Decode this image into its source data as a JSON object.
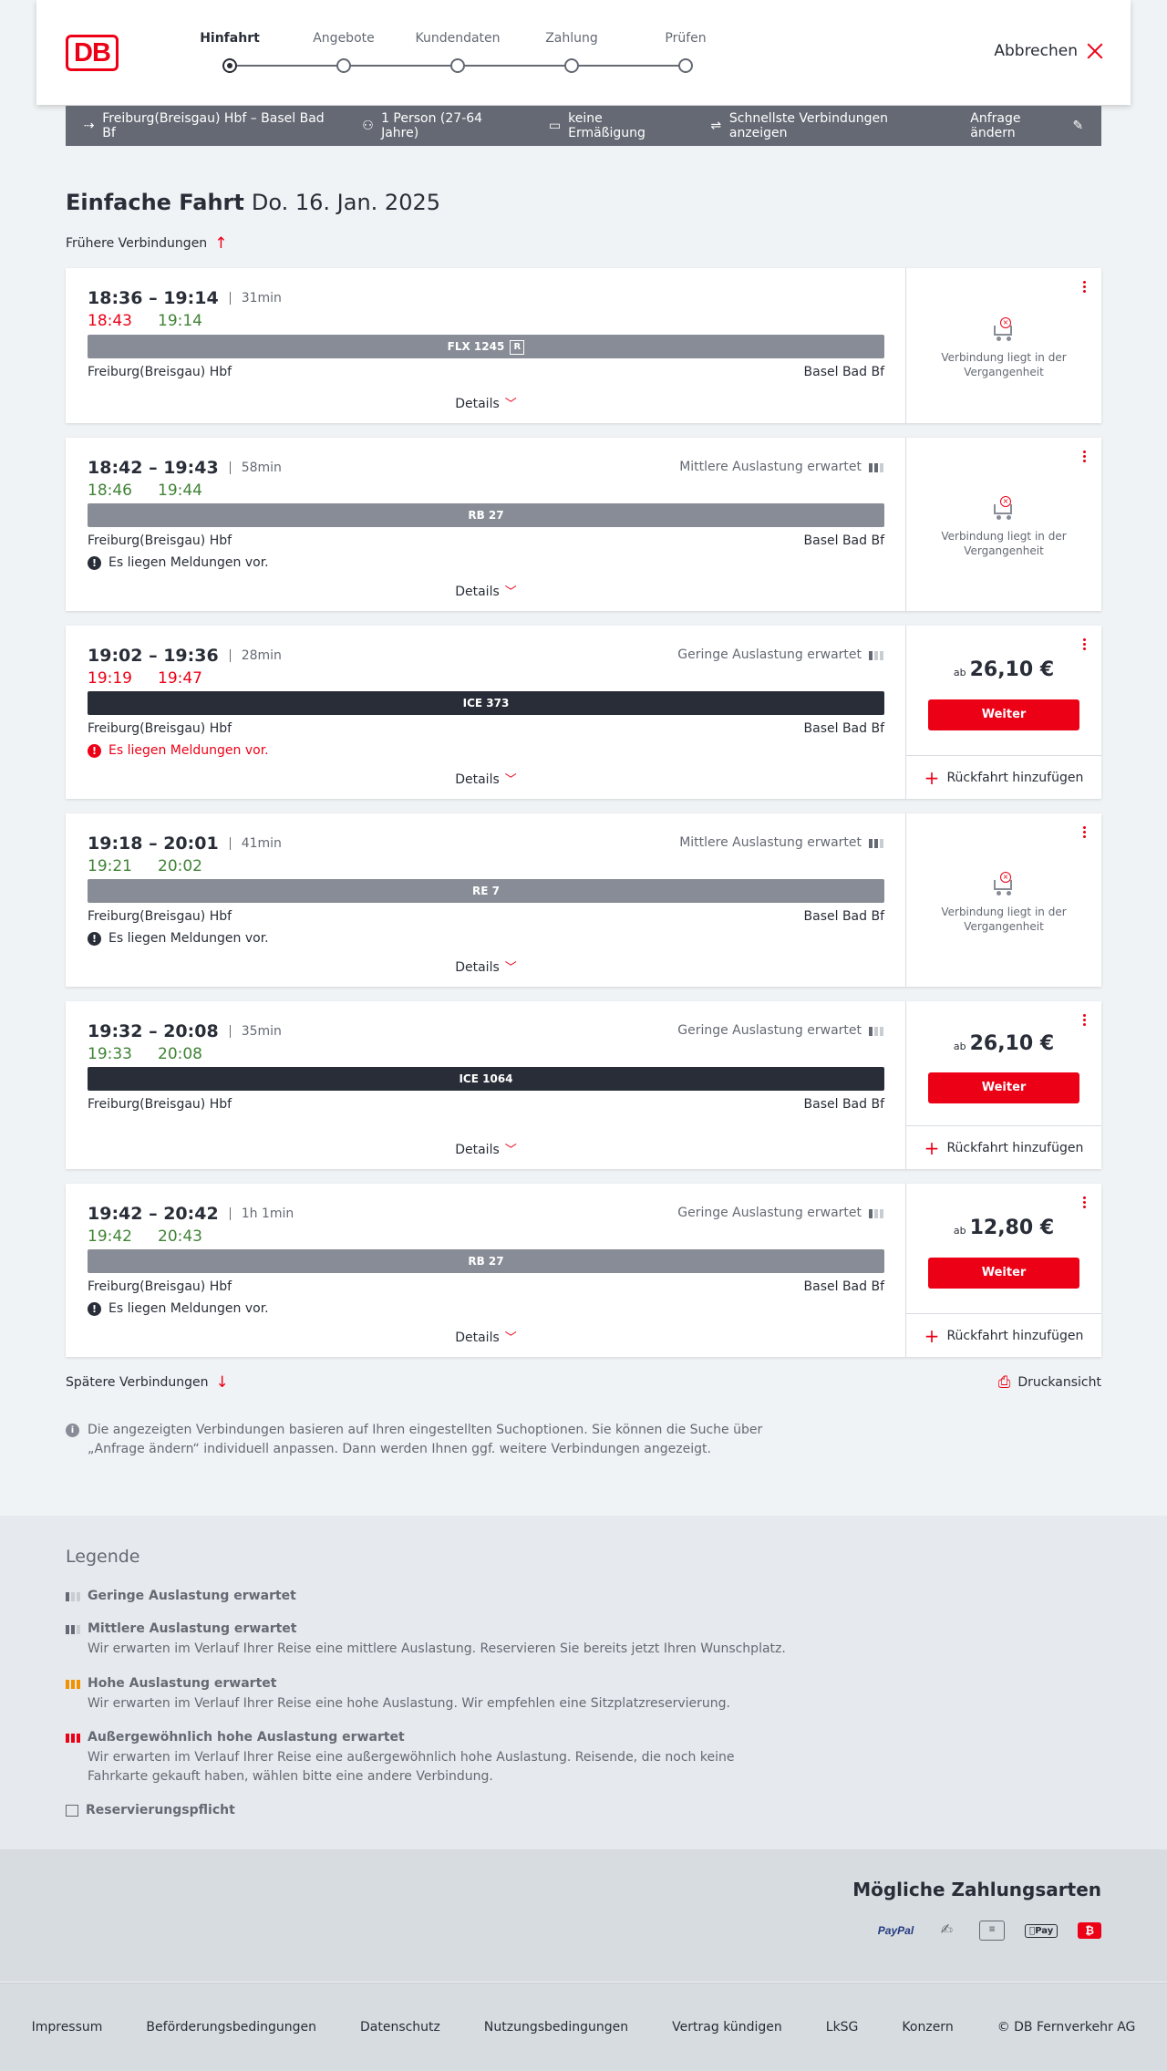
{
  "header": {
    "logo": "DB",
    "steps": [
      "Hinfahrt",
      "Angebote",
      "Kundendaten",
      "Zahlung",
      "Prüfen"
    ],
    "cancel_label": "Abbrechen"
  },
  "summary": {
    "route": "Freiburg(Breisgau) Hbf – Basel Bad Bf",
    "persons": "1 Person (27-64 Jahre)",
    "discount": "keine Ermäßigung",
    "fastest": "Schnellste Verbindungen anzeigen",
    "edit": "Anfrage ändern"
  },
  "title": {
    "type": "Einfache Fahrt",
    "date": "Do. 16. Jan. 2025"
  },
  "earlier_label": "Frühere Verbindungen",
  "later_label": "Spätere Verbindungen",
  "print_label": "Druckansicht",
  "details_label": "Details",
  "return_label": "Rückfahrt hinzufügen",
  "weiter_label": "Weiter",
  "past_label": "Verbindung liegt in der Vergangenheit",
  "price_prefix": "ab",
  "connections": [
    {
      "times": "18:36 – 19:14",
      "duration": "31min",
      "rt_dep": "18:43",
      "rt_arr": "19:14",
      "occupancy": "",
      "train": "FLX 1245",
      "from": "Freiburg(Breisgau) Hbf",
      "to": "Basel Bad Bf",
      "message": "",
      "price": ""
    },
    {
      "times": "18:42 – 19:43",
      "duration": "58min",
      "rt_dep": "18:46",
      "rt_arr": "19:44",
      "occupancy": "Mittlere Auslastung erwartet",
      "train": "RB 27",
      "from": "Freiburg(Breisgau) Hbf",
      "to": "Basel Bad Bf",
      "message": "Es liegen Meldungen vor.",
      "price": ""
    },
    {
      "times": "19:02 – 19:36",
      "duration": "28min",
      "rt_dep": "19:19",
      "rt_arr": "19:47",
      "occupancy": "Geringe Auslastung erwartet",
      "train": "ICE 373",
      "from": "Freiburg(Breisgau) Hbf",
      "to": "Basel Bad Bf",
      "message": "Es liegen Meldungen vor.",
      "price": "26,10 €"
    },
    {
      "times": "19:18 – 20:01",
      "duration": "41min",
      "rt_dep": "19:21",
      "rt_arr": "20:02",
      "occupancy": "Mittlere Auslastung erwartet",
      "train": "RE 7",
      "from": "Freiburg(Breisgau) Hbf",
      "to": "Basel Bad Bf",
      "message": "Es liegen Meldungen vor.",
      "price": ""
    },
    {
      "times": "19:32 – 20:08",
      "duration": "35min",
      "rt_dep": "19:33",
      "rt_arr": "20:08",
      "occupancy": "Geringe Auslastung erwartet",
      "train": "ICE 1064",
      "from": "Freiburg(Breisgau) Hbf",
      "to": "Basel Bad Bf",
      "message": "",
      "price": "26,10 €"
    },
    {
      "times": "19:42 – 20:42",
      "duration": "1h 1min",
      "rt_dep": "19:42",
      "rt_arr": "20:43",
      "occupancy": "Geringe Auslastung erwartet",
      "train": "RB 27",
      "from": "Freiburg(Breisgau) Hbf",
      "to": "Basel Bad Bf",
      "message": "Es liegen Meldungen vor.",
      "price": "12,80 €"
    }
  ],
  "info_text": "Die angezeigten Verbindungen basieren auf Ihren eingestellten Suchoptionen. Sie können die Suche über „Anfrage ändern“ individuell anpassen. Dann werden Ihnen ggf. weitere Verbindungen angezeigt.",
  "legend": {
    "title": "Legende",
    "items": [
      {
        "heading": "Geringe Auslastung erwartet",
        "text": ""
      },
      {
        "heading": "Mittlere Auslastung erwartet",
        "text": "Wir erwarten im Verlauf Ihrer Reise eine mittlere Auslastung. Reservieren Sie bereits jetzt Ihren Wunschplatz."
      },
      {
        "heading": "Hohe Auslastung erwartet",
        "text": "Wir erwarten im Verlauf Ihrer Reise eine hohe Auslastung. Wir empfehlen eine Sitzplatzreservierung."
      },
      {
        "heading": "Außergewöhnlich hohe Auslastung erwartet",
        "text": "Wir erwarten im Verlauf Ihrer Reise eine außergewöhnlich hohe Auslastung. Reisende, die noch keine Fahrkarte gekauft haben, wählen bitte eine andere Verbindung."
      },
      {
        "heading": "Reservierungspflicht",
        "text": ""
      }
    ]
  },
  "payments": {
    "title": "Mögliche Zahlungsarten",
    "paypal": "PayPal",
    "apple": "Pay"
  },
  "footer": [
    "Impressum",
    "Beförderungsbedingungen",
    "Datenschutz",
    "Nutzungsbedingungen",
    "Vertrag kündigen",
    "LkSG",
    "Konzern",
    "© DB Fernverkehr AG"
  ],
  "colors": {
    "accent": "#ec0016",
    "ok": "#408335",
    "dark": "#282d37",
    "grey": "#646973"
  }
}
